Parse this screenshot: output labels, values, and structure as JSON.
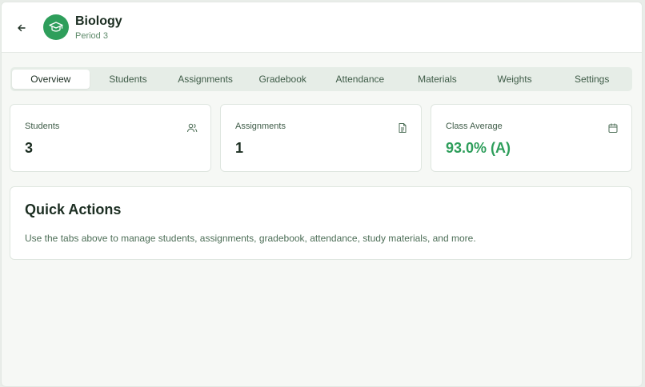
{
  "header": {
    "title": "Biology",
    "subtitle": "Period 3"
  },
  "tabs": [
    {
      "label": "Overview",
      "active": true
    },
    {
      "label": "Students"
    },
    {
      "label": "Assignments"
    },
    {
      "label": "Gradebook"
    },
    {
      "label": "Attendance"
    },
    {
      "label": "Materials"
    },
    {
      "label": "Weights"
    },
    {
      "label": "Settings"
    }
  ],
  "stats": {
    "students": {
      "label": "Students",
      "value": "3",
      "icon": "users-icon"
    },
    "assignments": {
      "label": "Assignments",
      "value": "1",
      "icon": "document-icon"
    },
    "class_average": {
      "label": "Class Average",
      "value": "93.0% (A)",
      "icon": "calendar-icon"
    }
  },
  "quick_actions": {
    "title": "Quick Actions",
    "text": "Use the tabs above to manage students, assignments, gradebook, attendance, study materials, and more."
  },
  "colors": {
    "accent": "#2e9e5b",
    "background": "#f6f8f5"
  }
}
